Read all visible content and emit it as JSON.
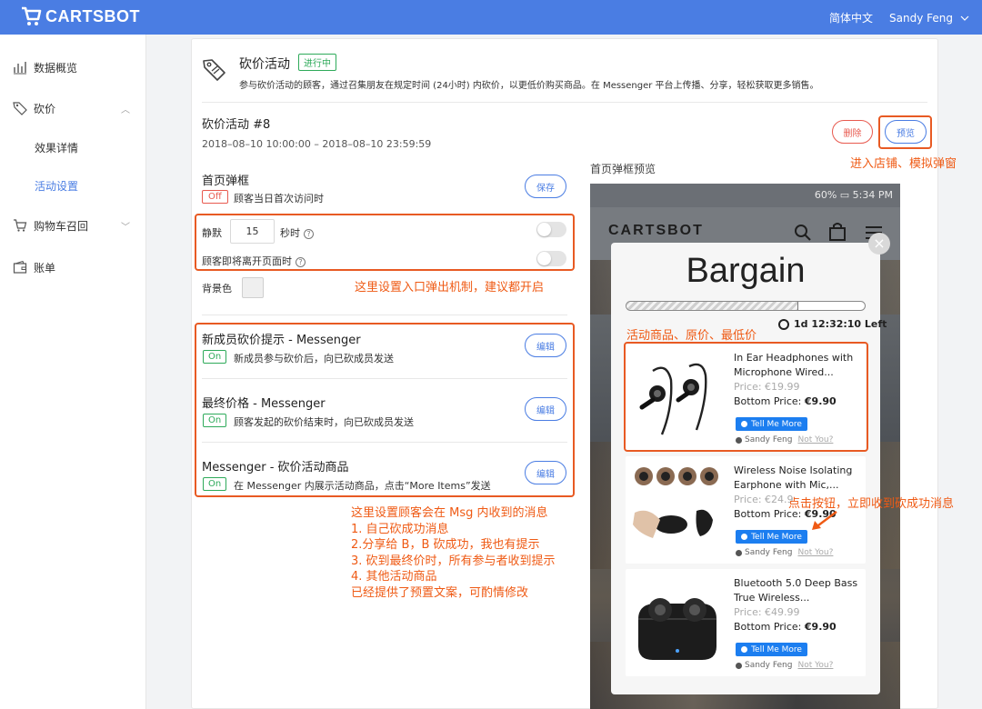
{
  "topbar": {
    "brand": "CARTSBOT",
    "language": "简体中文",
    "user": "Sandy Feng"
  },
  "sidebar": {
    "items": [
      {
        "label": "数据概览",
        "icon": "bar-chart-icon"
      },
      {
        "label": "砍价",
        "icon": "tag-icon"
      },
      {
        "label": "效果详情"
      },
      {
        "label": "活动设置"
      },
      {
        "label": "购物车召回",
        "icon": "cart-icon"
      },
      {
        "label": "账单",
        "icon": "wallet-icon"
      }
    ]
  },
  "page": {
    "title": "砍价活动",
    "status_badge": "进行中",
    "description": "参与砍价活动的顾客，通过召集朋友在规定时间 (24小时) 内砍价，以更低价购买商品。在 Messenger 平台上传播、分享，轻松获取更多销售。"
  },
  "activity": {
    "name": "砍价活动 #8",
    "time_range": "2018–08–10 10:00:00 – 2018–08–10 23:59:59",
    "delete_label": "删除",
    "preview_label": "预览"
  },
  "popup": {
    "title": "首页弹框",
    "state": "Off",
    "desc": "顾客当日首次访问时",
    "save_label": "保存",
    "idle_label": "静默",
    "idle_seconds": "15",
    "idle_unit": "秒时",
    "leave_label": "顾客即将离开页面时",
    "bg_label": "背景色",
    "help_glyph": "?"
  },
  "messages": [
    {
      "title": "新成员砍价提示 - Messenger",
      "state": "On",
      "desc": "新成员参与砍价后，向已砍成员发送",
      "edit": "编辑"
    },
    {
      "title": "最终价格 - Messenger",
      "state": "On",
      "desc": "顾客发起的砍价结束时，向已砍成员发送",
      "edit": "编辑"
    },
    {
      "title": "Messenger - 砍价活动商品",
      "state": "On",
      "desc": "在 Messenger 内展示活动商品，点击“More Items”发送",
      "edit": "编辑"
    }
  ],
  "annotations": {
    "preview_note": "进入店铺、模拟弹窗",
    "trigger_note": "这里设置入口弹出机制，建议都开启",
    "product_note": "活动商品、原价、最低价",
    "click_note": "点击按钮，立即收到砍成功消息",
    "msg_notes": [
      "这里设置顾客会在 Msg 内收到的消息",
      "1. 自己砍成功消息",
      "2.分享给 B，B 砍成功，我也有提示",
      "3. 砍到最终价时，所有参与者收到提示",
      "4. 其他活动商品",
      "已经提供了预置文案，可酌情修改"
    ]
  },
  "preview": {
    "title": "首页弹框预览",
    "status_bar": "60% ▭ 5:34 PM",
    "brand": "CARTSBOT",
    "close_glyph": "×",
    "bargain_title": "Bargain",
    "progress_fraction": 0.72,
    "timer": "1d 12:32:10 Left",
    "products": [
      {
        "name": "In Ear Headphones with Microphone Wired...",
        "price": "Price: €19.99",
        "bottom_label": "Bottom Price:",
        "bottom_value": "€9.90",
        "button": "Tell Me More",
        "user": "Sandy Feng",
        "not_you": "Not You?"
      },
      {
        "name": "Wireless Noise Isolating Earphone with Mic,...",
        "price": "Price: €24.9",
        "bottom_label": "Bottom Price:",
        "bottom_value": "€9.90",
        "button": "Tell Me More",
        "user": "Sandy Feng",
        "not_you": "Not You?"
      },
      {
        "name": "Bluetooth 5.0 Deep Bass True Wireless...",
        "price": "Price: €49.99",
        "bottom_label": "Bottom Price:",
        "bottom_value": "€9.90",
        "button": "Tell Me More",
        "user": "Sandy Feng",
        "not_you": "Not You?"
      }
    ]
  },
  "colors": {
    "primary": "#4a7de3",
    "danger": "#e85a4f",
    "success": "#2eaa5a",
    "annotation": "#ef5a14",
    "messenger_blue": "#1c7ef0"
  }
}
